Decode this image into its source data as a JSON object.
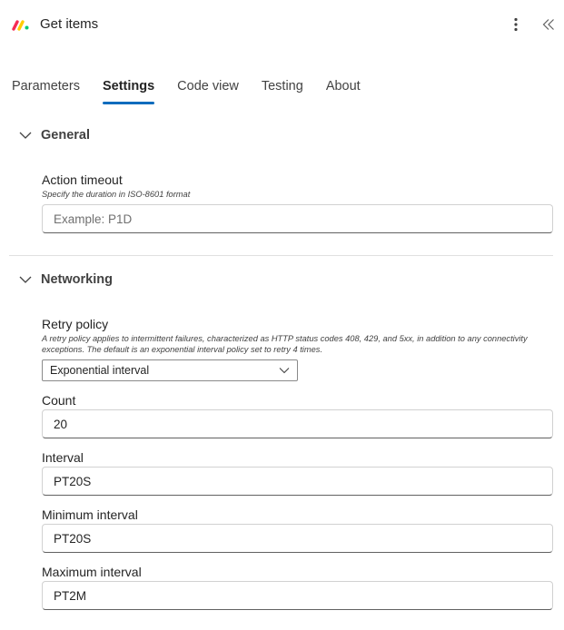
{
  "header": {
    "title": "Get items",
    "logo_icon": "monday-logo-icon",
    "more_icon": "more-vertical-icon",
    "collapse_icon": "double-chevron-left-icon"
  },
  "tabs": [
    {
      "label": "Parameters",
      "active": false
    },
    {
      "label": "Settings",
      "active": true
    },
    {
      "label": "Code view",
      "active": false
    },
    {
      "label": "Testing",
      "active": false
    },
    {
      "label": "About",
      "active": false
    }
  ],
  "colors": {
    "accent": "#0f6cbd",
    "logo_red": "#f62b54",
    "logo_yellow": "#ffcc00",
    "logo_green": "#00ca72"
  },
  "general": {
    "title": "General",
    "action_timeout": {
      "label": "Action timeout",
      "description": "Specify the duration in ISO-8601 format",
      "placeholder": "Example: P1D",
      "value": ""
    }
  },
  "networking": {
    "title": "Networking",
    "retry_policy": {
      "label": "Retry policy",
      "description": "A retry policy applies to intermittent failures, characterized as HTTP status codes 408, 429, and 5xx, in addition to any connectivity exceptions. The default is an exponential interval policy set to retry 4 times.",
      "selected": "Exponential interval"
    },
    "count": {
      "label": "Count",
      "value": "20"
    },
    "interval": {
      "label": "Interval",
      "value": "PT20S"
    },
    "minimum_interval": {
      "label": "Minimum interval",
      "value": "PT20S"
    },
    "maximum_interval": {
      "label": "Maximum interval",
      "value": "PT2M"
    }
  }
}
